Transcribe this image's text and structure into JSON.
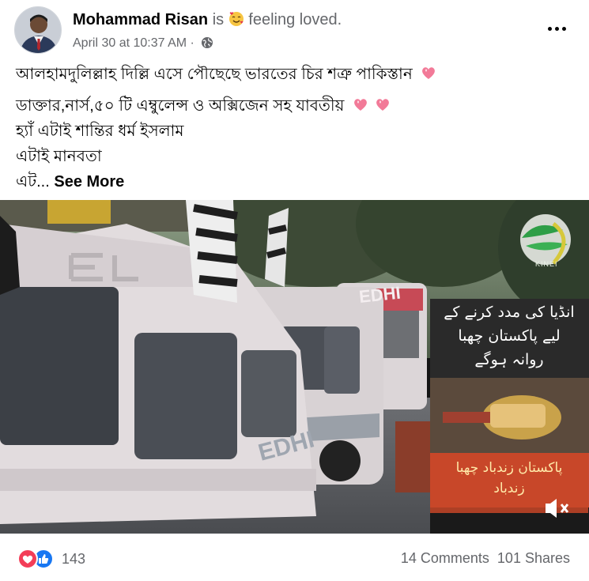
{
  "post": {
    "author": "Mohammad Risan",
    "is_text": "is",
    "feeling_emoji": "smiling-face-with-hearts",
    "feeling_text": "feeling loved.",
    "timestamp": "April 30 at 10:37 AM",
    "separator": "·",
    "audience_icon": "globe-icon",
    "more_options_icon": "more-horizontal-icon"
  },
  "text": {
    "line1": "আলহামদুলিল্লাহ দিল্লি এসে পৌছেছে ভারতের  চির শত্রু পাকিস্তান",
    "line2": "ডাক্তার,নার্স,৫০ টি এম্বুলেন্স ও অক্সিজেন সহ যাবতীয়",
    "line3": "হ্যাঁ এটাই শান্তির ধর্ম ইসলাম",
    "line4": "এটাই মানবতা",
    "line5_prefix": "এট...",
    "see_more": "See More",
    "heart_emoji": "sparkling-heart"
  },
  "video": {
    "caption_top_line1": "انڈیا کی مدد کرنے کے",
    "caption_top_line2": "لیے پاکستان چھبا",
    "caption_top_line3": "روانہ ہوگے",
    "caption_bottom_line1": "پاکستان زندباد چھبا",
    "caption_bottom_line2": "زندباد",
    "brand": "KINEI",
    "van_label_1": "EDHI",
    "van_label_2": "EDHI",
    "mute_icon": "speaker-muted-icon"
  },
  "footer": {
    "reaction_count": "143",
    "comments": "14 Comments",
    "shares": "101 Shares"
  },
  "colors": {
    "love": "#f33e58",
    "like": "#1877f2",
    "muted_text": "#65676b"
  }
}
